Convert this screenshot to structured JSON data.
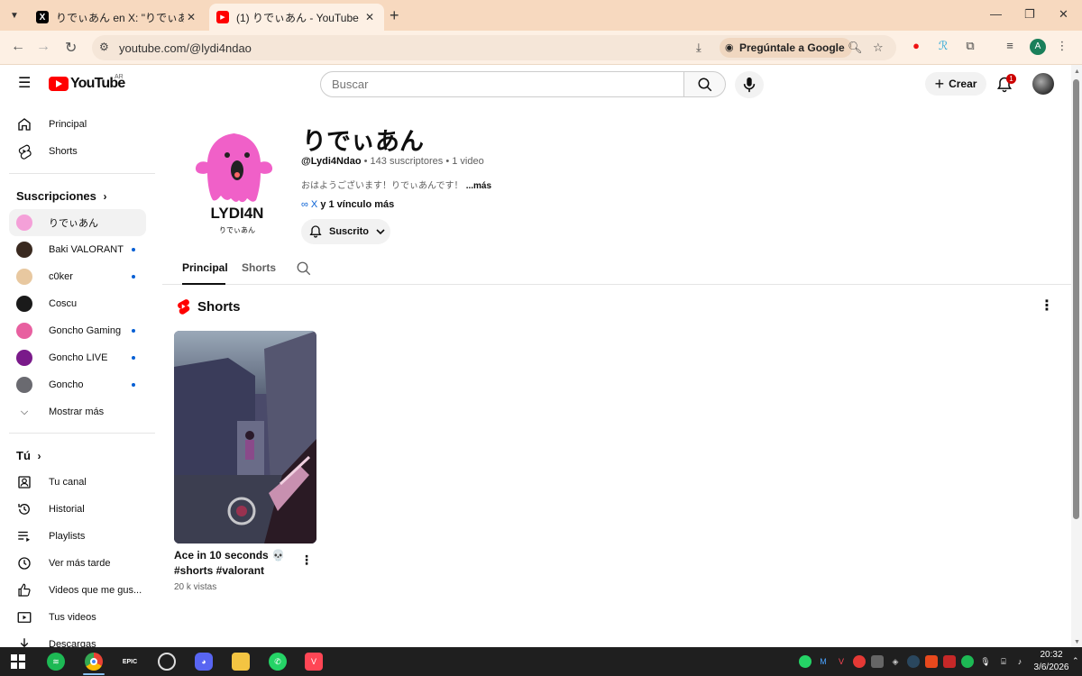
{
  "browser": {
    "tabs": [
      {
        "title": "りでぃあん en X: \"りでぃあん初プレビ",
        "favicon": "x-logo-icon",
        "active": false
      },
      {
        "title": "(1) りでぃあん - YouTube",
        "favicon": "youtube-icon",
        "active": true
      }
    ],
    "url": "youtube.com/@lydi4ndao",
    "ask_google": "Pregúntale a Google",
    "profile_initial": "A"
  },
  "youtube": {
    "logo_text": "YouTube",
    "country_code": "AR",
    "search_placeholder": "Buscar",
    "create_label": "Crear",
    "notification_count": "1"
  },
  "sidebar": {
    "main": [
      {
        "label": "Principal",
        "icon": "home-icon"
      },
      {
        "label": "Shorts",
        "icon": "shorts-icon"
      }
    ],
    "subscriptions_heading": "Suscripciones",
    "subscriptions": [
      {
        "label": "りでぃあん",
        "new": false,
        "color": "#f4a0d8"
      },
      {
        "label": "Baki VALORANT",
        "new": true,
        "color": "#3a2a20"
      },
      {
        "label": "c0ker",
        "new": true,
        "color": "#e8c8a0"
      },
      {
        "label": "Coscu",
        "new": false,
        "color": "#1a1a1a"
      },
      {
        "label": "Goncho Gaming",
        "new": true,
        "color": "#e860a0"
      },
      {
        "label": "Goncho LIVE",
        "new": true,
        "color": "#7a1a8a"
      },
      {
        "label": "Goncho",
        "new": true,
        "color": "#6a6a70"
      }
    ],
    "show_more": "Mostrar más",
    "you_heading": "Tú",
    "you_items": [
      {
        "label": "Tu canal",
        "icon": "channel-icon"
      },
      {
        "label": "Historial",
        "icon": "history-icon"
      },
      {
        "label": "Playlists",
        "icon": "playlists-icon"
      },
      {
        "label": "Ver más tarde",
        "icon": "watch-later-icon"
      },
      {
        "label": "Videos que me gus...",
        "icon": "like-icon"
      },
      {
        "label": "Tus videos",
        "icon": "your-videos-icon"
      },
      {
        "label": "Descargas",
        "icon": "download-icon"
      }
    ]
  },
  "channel": {
    "name": "りでぃあん",
    "handle": "@Lydi4Ndao",
    "subscribers": "143 suscriptores",
    "videos": "1 video",
    "description": "おはようございます！りでぃあんです！",
    "more_label": "...más",
    "link_x": "X",
    "more_links": "y 1 vínculo más",
    "subscribe_state": "Suscrito",
    "avatar_text": "LYDI4N",
    "avatar_subtext": "りでぃあん",
    "avatar_color": "#f060c8"
  },
  "channel_tabs": [
    {
      "label": "Principal",
      "active": true
    },
    {
      "label": "Shorts",
      "active": false
    }
  ],
  "shorts_section": {
    "title": "Shorts",
    "items": [
      {
        "title": "Ace in 10 seconds 💀 #shorts  #valorant",
        "views": "20 k vistas"
      }
    ]
  },
  "taskbar": {
    "time": "20:32",
    "date": "3/6/2026",
    "apps": [
      "windows-start-icon",
      "spotify-icon",
      "chrome-icon",
      "epic-games-icon",
      "obs-icon",
      "discord-icon",
      "file-explorer-icon",
      "whatsapp-icon",
      "valorant-icon"
    ],
    "epic_label": "EPIC"
  }
}
